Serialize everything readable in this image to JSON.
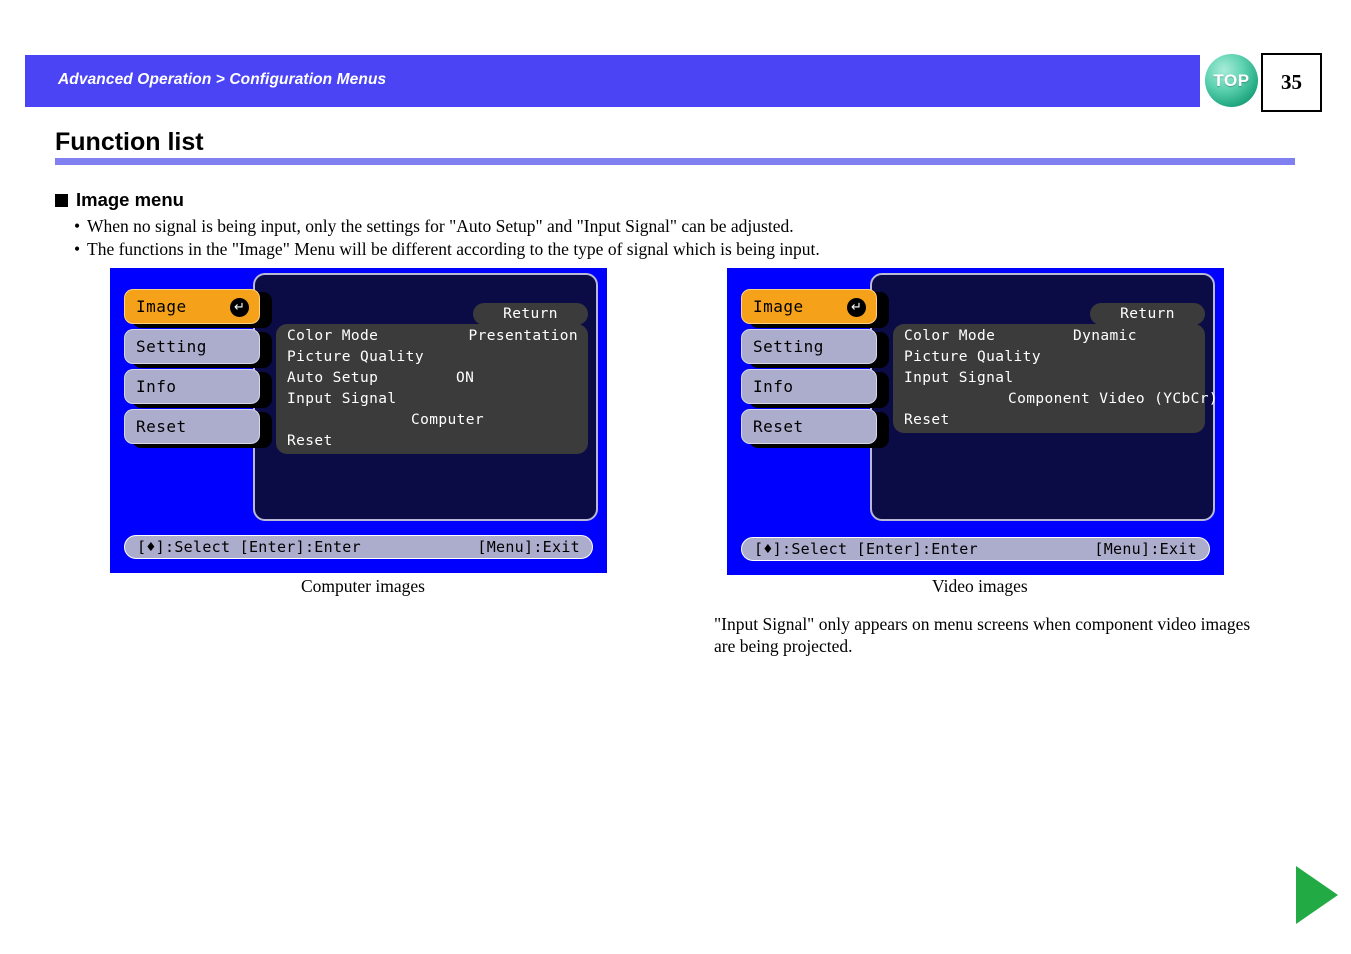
{
  "header": {
    "breadcrumb": "Advanced Operation > Configuration Menus",
    "top_button_label": "TOP",
    "page_number": "35",
    "bar_color": "#4b44f5"
  },
  "title": {
    "text": "Function list",
    "rule_color": "#8080f0"
  },
  "section": {
    "heading": "Image menu",
    "notes": [
      "When no signal is being input, only the settings for \"Auto Setup\" and \"Input Signal\" can be adjusted.",
      "The functions in the \"Image\" Menu will be different according to the type of signal which is being input."
    ],
    "bullet": "•"
  },
  "osd_left": {
    "caption": "Computer images",
    "sidebar": [
      {
        "label": "Image",
        "selected": true,
        "enter_icon": "↵"
      },
      {
        "label": "Setting",
        "selected": false
      },
      {
        "label": "Info",
        "selected": false
      },
      {
        "label": "Reset",
        "selected": false
      }
    ],
    "return_label": "Return",
    "rows": [
      {
        "label": "Color Mode",
        "value": "Presentation",
        "value_pos": "pos-right"
      },
      {
        "label": "Picture Quality",
        "value": "",
        "value_pos": "pos-right"
      },
      {
        "label": "Auto Setup",
        "value": "ON",
        "value_pos": "pos-mid3"
      },
      {
        "label": "Input Signal",
        "value": "",
        "value_pos": "pos-right"
      },
      {
        "label": "",
        "value": "Computer",
        "value_pos": "pos-mid"
      },
      {
        "label": "Reset",
        "value": "",
        "value_pos": "pos-right"
      }
    ],
    "hint_left": "[♦]:Select [Enter]:Enter",
    "hint_right": "[Menu]:Exit"
  },
  "osd_right": {
    "caption": "Video images",
    "sidebar": [
      {
        "label": "Image",
        "selected": true,
        "enter_icon": "↵"
      },
      {
        "label": "Setting",
        "selected": false
      },
      {
        "label": "Info",
        "selected": false
      },
      {
        "label": "Reset",
        "selected": false
      }
    ],
    "return_label": "Return",
    "rows": [
      {
        "label": "Color Mode",
        "value": "Dynamic",
        "value_pos": "pos-mid3"
      },
      {
        "label": "Picture Quality",
        "value": "",
        "value_pos": "pos-right"
      },
      {
        "label": "Input Signal",
        "value": "",
        "value_pos": "pos-right"
      },
      {
        "label": "",
        "value": "Component Video (YCbCr)",
        "value_pos": "pos-mid2"
      },
      {
        "label": "Reset",
        "value": "",
        "value_pos": "pos-right"
      }
    ],
    "hint_left": "[♦]:Select [Enter]:Enter",
    "hint_right": "[Menu]:Exit"
  },
  "right_note": "\"Input Signal\" only appears on menu screens when component video images are being projected.",
  "next_page_arrow_color": "#22aa44"
}
